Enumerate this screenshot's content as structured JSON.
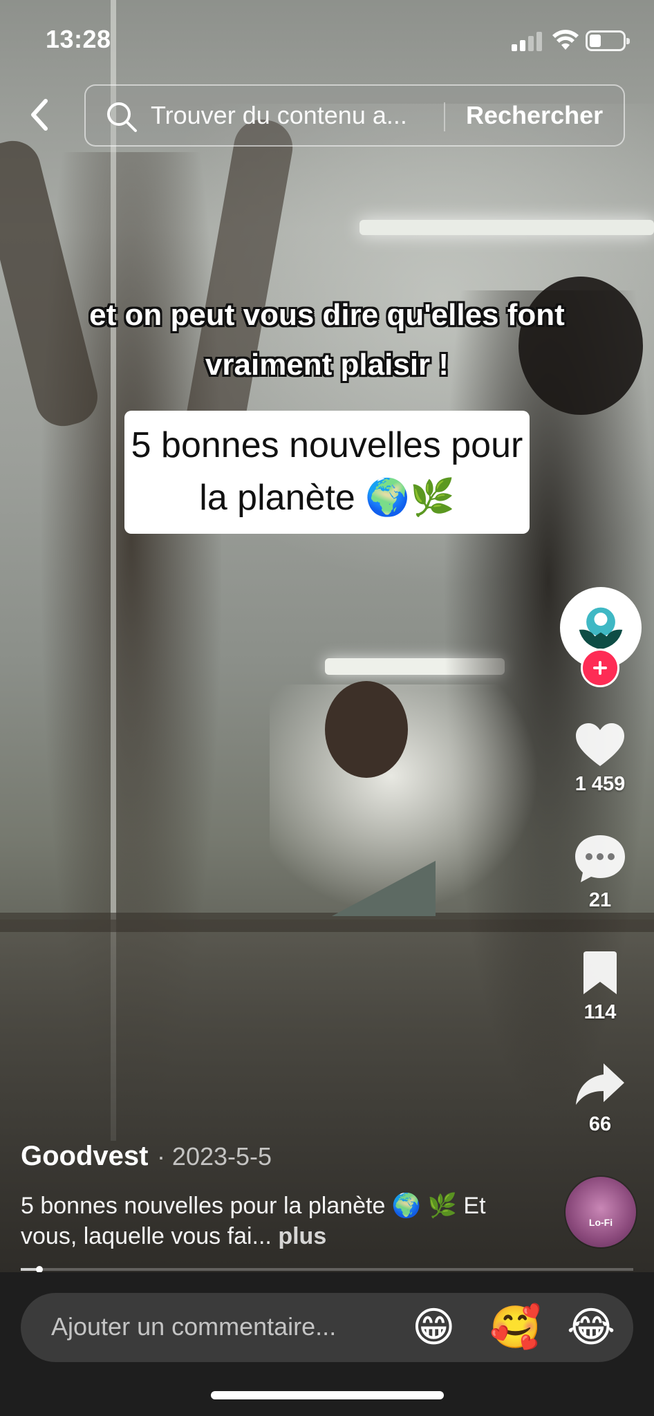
{
  "status_bar": {
    "time": "13:28"
  },
  "search": {
    "placeholder": "Trouver du contenu a...",
    "button": "Rechercher"
  },
  "video": {
    "subtitle": "et on peut vous dire qu'elles font vraiment plaisir !",
    "title_card": "5 bonnes nouvelles pour la planète 🌍🌿"
  },
  "actions": {
    "likes": "1 459",
    "comments": "21",
    "saves": "114",
    "shares": "66"
  },
  "post": {
    "author": "Goodvest",
    "date": "· 2023-5-5",
    "caption": "5 bonnes nouvelles pour la planète 🌍 🌿 Et vous, laquelle vous fai...",
    "more": "plus",
    "music_disc_label": "Lo-Fi",
    "progress": 0.03
  },
  "comment_bar": {
    "placeholder": "Ajouter un commentaire...",
    "emojis": [
      "😁",
      "🥰",
      "😂"
    ]
  },
  "colors": {
    "accent": "#fe2c55",
    "bar_bg": "#1e1e1e",
    "input_bg": "#3b3b3b"
  }
}
